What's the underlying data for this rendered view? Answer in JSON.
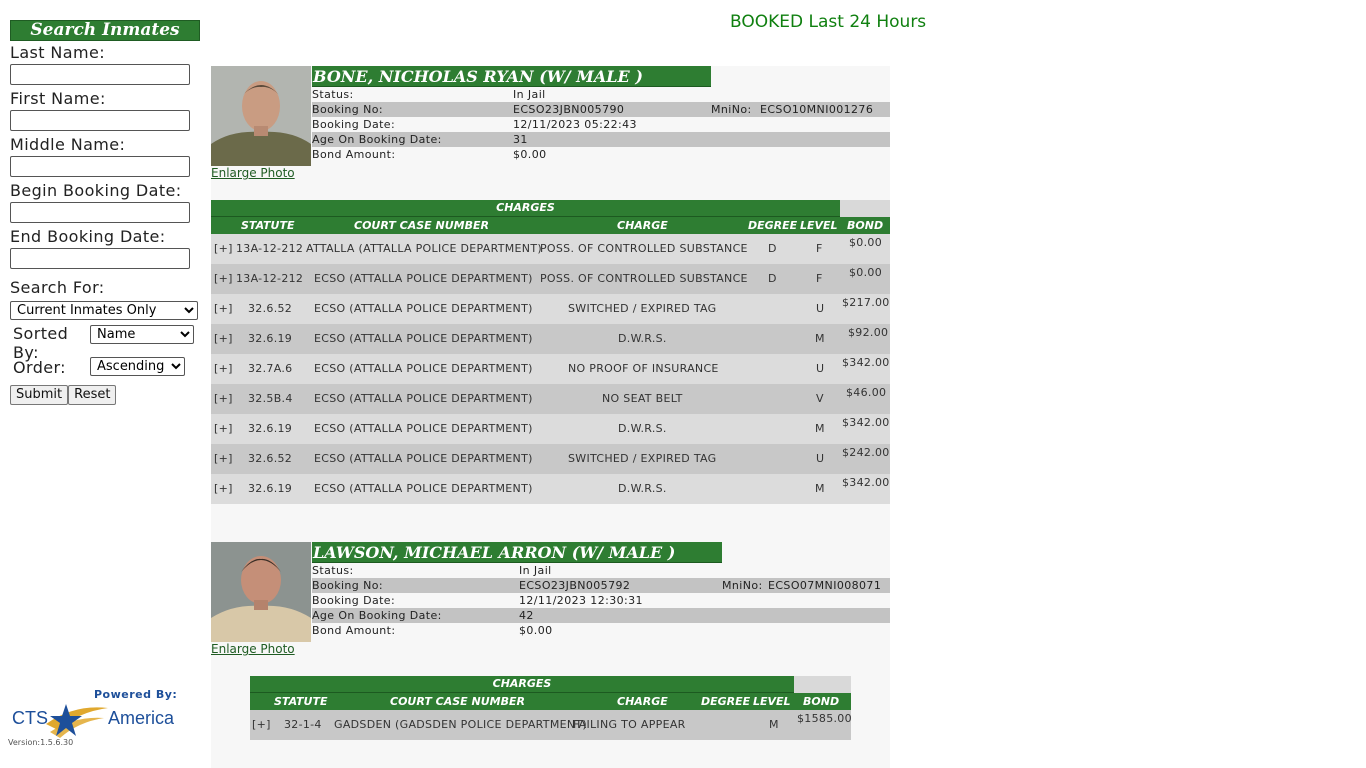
{
  "sidebar": {
    "title": "Search Inmates",
    "last_name_label": "Last Name:",
    "first_name_label": "First Name:",
    "middle_name_label": "Middle Name:",
    "begin_date_label": "Begin Booking Date:",
    "end_date_label": "End Booking Date:",
    "search_for_label": "Search For:",
    "search_for_value": "Current Inmates Only",
    "sorted_by_label": "Sorted By:",
    "sorted_by_value": "Name",
    "order_label": "Order:",
    "order_value": "Ascending",
    "submit_label": "Submit",
    "reset_label": "Reset"
  },
  "footer": {
    "powered_by": "Powered By:",
    "brand_left": "CTS",
    "brand_right": "America",
    "version": "Version:1.5.6.30"
  },
  "header": {
    "title": "BOOKED Last 24 Hours"
  },
  "labels": {
    "status": "Status:",
    "booking_no": "Booking No:",
    "mnino": "MniNo:",
    "booking_date": "Booking Date:",
    "age": "Age On Booking Date:",
    "bond_amount": "Bond Amount:",
    "enlarge": "Enlarge Photo",
    "charges_title": "CHARGES",
    "col_statute": "STATUTE",
    "col_case": "COURT CASE NUMBER",
    "col_charge": "CHARGE",
    "col_degree": "DEGREE",
    "col_level": "LEVEL",
    "col_bond": "BOND",
    "expand": "[+]"
  },
  "inmates": [
    {
      "name": "BONE, NICHOLAS RYAN   (W/ MALE )",
      "status": "In Jail",
      "booking_no": "ECSO23JBN005790",
      "mnino": "ECSO10MNI001276",
      "booking_date": "12/11/2023 05:22:43",
      "age": "31",
      "bond_amount": "$0.00",
      "charges": [
        {
          "statute": "13A-12-212",
          "case": "ATTALLA (ATTALLA POLICE DEPARTMENT)",
          "charge": "POSS. OF CONTROLLED SUBSTANCE",
          "degree": "D",
          "level": "F",
          "bond": "$0.00"
        },
        {
          "statute": "13A-12-212",
          "case": "ECSO (ATTALLA POLICE DEPARTMENT)",
          "charge": "POSS. OF CONTROLLED SUBSTANCE",
          "degree": "D",
          "level": "F",
          "bond": "$0.00"
        },
        {
          "statute": "32.6.52",
          "case": "ECSO (ATTALLA POLICE DEPARTMENT)",
          "charge": "SWITCHED / EXPIRED TAG",
          "degree": "",
          "level": "U",
          "bond": "$217.00"
        },
        {
          "statute": "32.6.19",
          "case": "ECSO (ATTALLA POLICE DEPARTMENT)",
          "charge": "D.W.R.S.",
          "degree": "",
          "level": "M",
          "bond": "$92.00"
        },
        {
          "statute": "32.7A.6",
          "case": "ECSO (ATTALLA POLICE DEPARTMENT)",
          "charge": "NO PROOF OF INSURANCE",
          "degree": "",
          "level": "U",
          "bond": "$342.00"
        },
        {
          "statute": "32.5B.4",
          "case": "ECSO (ATTALLA POLICE DEPARTMENT)",
          "charge": "NO SEAT BELT",
          "degree": "",
          "level": "V",
          "bond": "$46.00"
        },
        {
          "statute": "32.6.19",
          "case": "ECSO (ATTALLA POLICE DEPARTMENT)",
          "charge": "D.W.R.S.",
          "degree": "",
          "level": "M",
          "bond": "$342.00"
        },
        {
          "statute": "32.6.52",
          "case": "ECSO (ATTALLA POLICE DEPARTMENT)",
          "charge": "SWITCHED / EXPIRED TAG",
          "degree": "",
          "level": "U",
          "bond": "$242.00"
        },
        {
          "statute": "32.6.19",
          "case": "ECSO (ATTALLA POLICE DEPARTMENT)",
          "charge": "D.W.R.S.",
          "degree": "",
          "level": "M",
          "bond": "$342.00"
        }
      ]
    },
    {
      "name": "LAWSON, MICHAEL ARRON   (W/ MALE )",
      "status": "In Jail",
      "booking_no": "ECSO23JBN005792",
      "mnino": "ECSO07MNI008071",
      "booking_date": "12/11/2023 12:30:31",
      "age": "42",
      "bond_amount": "$0.00",
      "charges": [
        {
          "statute": "32-1-4",
          "case": "GADSDEN (GADSDEN POLICE DEPARTMENT)",
          "charge": "FAILING TO APPEAR",
          "degree": "",
          "level": "M",
          "bond": "$1585.00"
        }
      ]
    }
  ],
  "colors": {
    "green": "#2e7d32",
    "header_green": "#108010"
  }
}
